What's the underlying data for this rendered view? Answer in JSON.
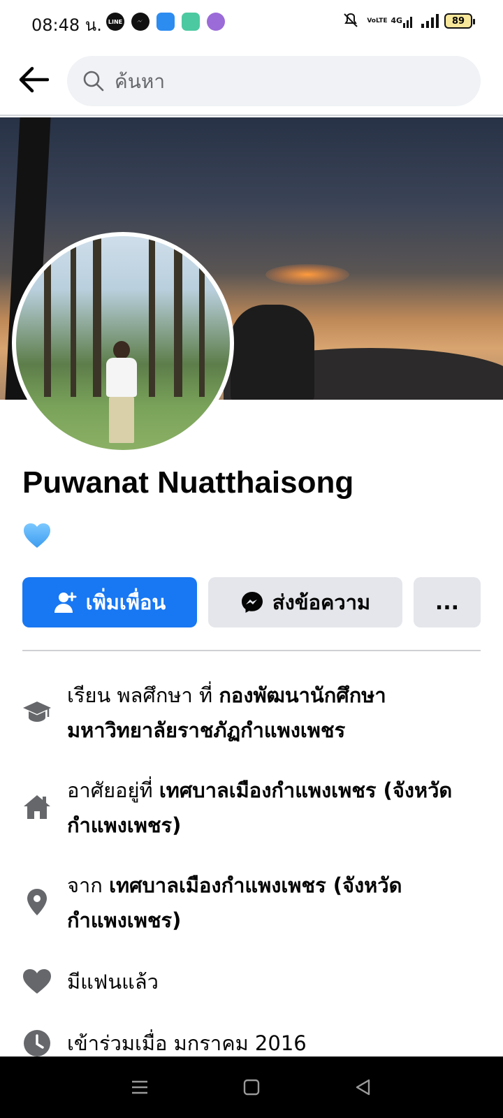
{
  "status_bar": {
    "time": "08:48 น.",
    "apps": [
      {
        "name": "line-icon",
        "label": "LINE",
        "color": "#111111"
      },
      {
        "name": "messenger-icon",
        "label": "",
        "color": "#111111"
      },
      {
        "name": "app-blue-icon",
        "label": "",
        "color": "#2d8cf0"
      },
      {
        "name": "app-green-icon",
        "label": "",
        "color": "#4cc9a0"
      },
      {
        "name": "app-purple-icon",
        "label": "",
        "color": "#9b6bd8"
      }
    ],
    "volte_label": "VoLTE",
    "network_label": "4G",
    "battery": "89"
  },
  "header": {
    "search_placeholder": "ค้นหา"
  },
  "profile": {
    "name": "Puwanat Nuatthaisong",
    "status_emoji": "blue-heart"
  },
  "actions": {
    "add_friend_label": "เพิ่มเพื่อน",
    "message_label": "ส่งข้อความ",
    "more_label": "..."
  },
  "details": {
    "education": {
      "prefix": "เรียน พลศึกษา ที่ ",
      "place": "กองพัฒนานักศึกษา มหาวิทยาลัยราชภัฏกำแพงเพชร"
    },
    "lives_in": {
      "prefix": "อาศัยอยู่ที่ ",
      "place": "เทศบาลเมืองกำแพงเพชร (จังหวัดกำแพงเพชร)"
    },
    "from": {
      "prefix": "จาก ",
      "place": "เทศบาลเมืองกำแพงเพชร (จังหวัดกำแพงเพชร)"
    },
    "relationship": "มีแฟนแล้ว",
    "joined": "เข้าร่วมเมื่อ มกราคม  2016"
  },
  "colors": {
    "primary": "#1877f2",
    "secondary_button": "#e4e6eb",
    "icon_gray": "#65676b"
  }
}
